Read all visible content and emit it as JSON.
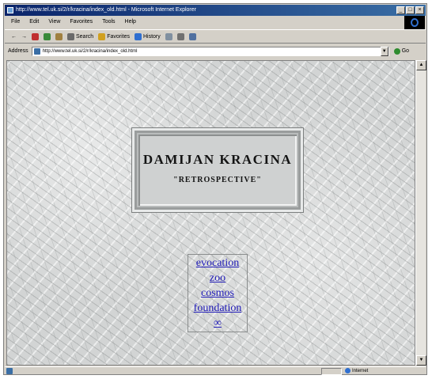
{
  "window": {
    "title": "http://www.tel.uk.si/2/r/kracina/index_old.html - Microsoft Internet Explorer",
    "buttons": [
      "_",
      "□",
      "×"
    ]
  },
  "menu": [
    "File",
    "Edit",
    "View",
    "Favorites",
    "Tools",
    "Help"
  ],
  "toolbar": {
    "back": "←",
    "forward": "→",
    "search": "Search",
    "favorites": "Favorites",
    "history": "History"
  },
  "address": {
    "label": "Address",
    "url": "http://www.tel.uk.si/2/r/kracina/index_old.html",
    "go": "Go"
  },
  "page": {
    "artist_name": "DAMIJAN KRACINA",
    "subtitle": "\"RETROSPECTIVE\"",
    "links": [
      "evocation",
      "zoo",
      "cosmos",
      "foundation",
      "∞"
    ]
  },
  "statusbar": {
    "zone": "Internet"
  },
  "colors": {
    "titlebar": "#0a246a",
    "link": "#1f1ab8",
    "chrome": "#d4d0c8"
  }
}
